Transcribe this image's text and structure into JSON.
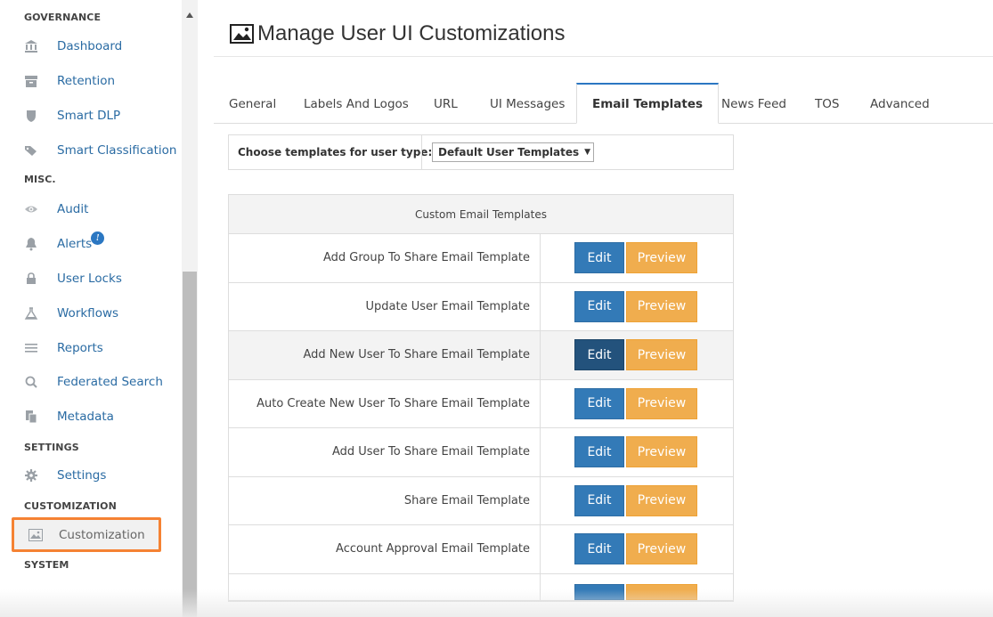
{
  "sidebar": {
    "sections": [
      {
        "header": "GOVERNANCE",
        "items": [
          {
            "label": "Dashboard",
            "icon": "bank-icon"
          },
          {
            "label": "Retention",
            "icon": "archive-icon"
          },
          {
            "label": "Smart DLP",
            "icon": "shield-icon"
          },
          {
            "label": "Smart Classification",
            "icon": "tags-icon"
          }
        ]
      },
      {
        "header": "MISC.",
        "items": [
          {
            "label": "Audit",
            "icon": "eye-icon"
          },
          {
            "label": "Alerts",
            "icon": "bell-icon",
            "badge": "!"
          },
          {
            "label": "User Locks",
            "icon": "lock-icon"
          },
          {
            "label": "Workflows",
            "icon": "flask-icon"
          },
          {
            "label": "Reports",
            "icon": "list-icon"
          },
          {
            "label": "Federated Search",
            "icon": "search-icon"
          },
          {
            "label": "Metadata",
            "icon": "copy-icon"
          }
        ]
      },
      {
        "header": "SETTINGS",
        "items": [
          {
            "label": "Settings",
            "icon": "gear-icon"
          }
        ]
      },
      {
        "header": "CUSTOMIZATION",
        "items": [
          {
            "label": "Customization",
            "icon": "picture-icon",
            "active": true
          }
        ]
      },
      {
        "header": "SYSTEM",
        "items": []
      }
    ]
  },
  "page": {
    "title": "Manage User UI Customizations"
  },
  "tabs": [
    {
      "label": "General"
    },
    {
      "label": "Labels And Logos"
    },
    {
      "label": "URL"
    },
    {
      "label": "UI Messages"
    },
    {
      "label": "Email Templates",
      "active": true
    },
    {
      "label": "News Feed"
    },
    {
      "label": "TOS"
    },
    {
      "label": "Advanced"
    }
  ],
  "filter": {
    "label": "Choose templates for user type:",
    "selected": "Default User Templates"
  },
  "templates": {
    "header": "Custom Email Templates",
    "edit_label": "Edit",
    "preview_label": "Preview",
    "rows": [
      {
        "name": "Add Group To Share Email Template"
      },
      {
        "name": "Update User Email Template"
      },
      {
        "name": "Add New User To Share Email Template",
        "hover": true
      },
      {
        "name": "Auto Create New User To Share Email Template"
      },
      {
        "name": "Add User To Share Email Template"
      },
      {
        "name": "Share Email Template"
      },
      {
        "name": "Account Approval Email Template"
      }
    ]
  },
  "colors": {
    "link": "#2a6ba3",
    "edit_button": "#337ab7",
    "edit_button_active": "#23527c",
    "preview_button": "#f0ad4e",
    "active_tab_border": "#2b77c2",
    "highlight_outline": "#f58233"
  }
}
